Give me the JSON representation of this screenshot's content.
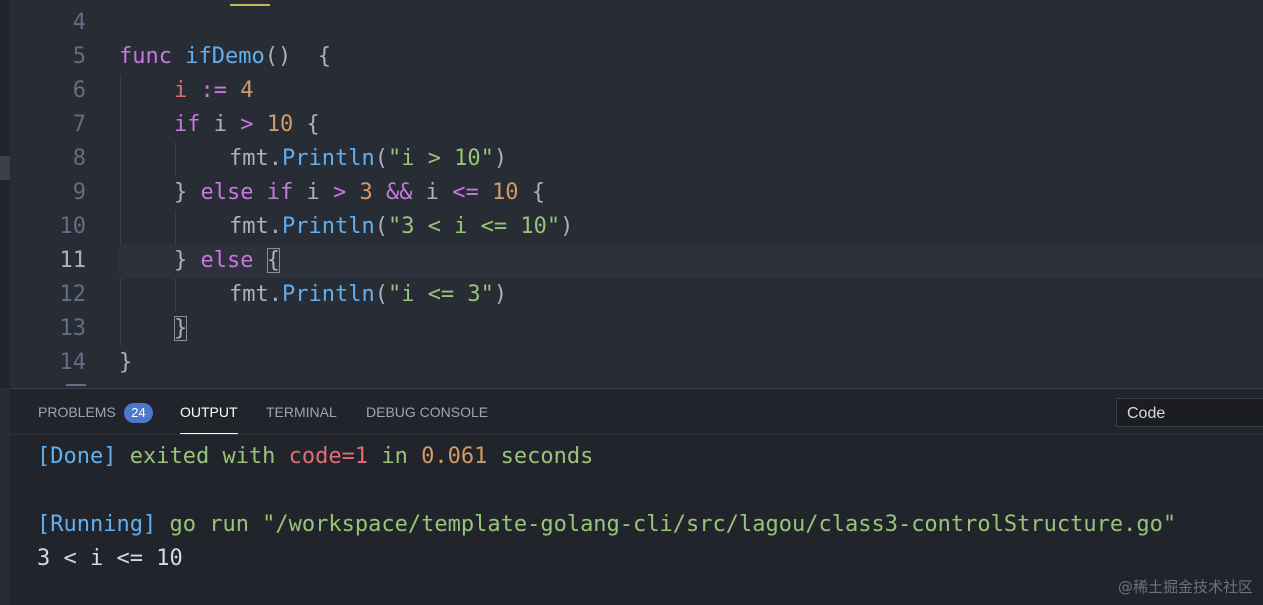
{
  "editor": {
    "active_line": "11",
    "lines": [
      {
        "num": "4"
      },
      {
        "num": "5",
        "t": [
          "func",
          " ",
          "ifDemo",
          "()  {"
        ]
      },
      {
        "num": "6",
        "t": [
          "i",
          " := ",
          "4"
        ]
      },
      {
        "num": "7",
        "t": [
          "if",
          " i ",
          ">",
          " ",
          "10",
          " {"
        ]
      },
      {
        "num": "8",
        "t": [
          "fmt.",
          "Println",
          "(",
          "\"i > 10\"",
          ")"
        ]
      },
      {
        "num": "9",
        "t": [
          "} ",
          "else if",
          " i ",
          ">",
          " ",
          "3",
          " ",
          "&&",
          " i ",
          "<=",
          " ",
          "10",
          " {"
        ]
      },
      {
        "num": "10",
        "t": [
          "fmt.",
          "Println",
          "(",
          "\"3 < i <= 10\"",
          ")"
        ]
      },
      {
        "num": "11",
        "t": [
          "} ",
          "else",
          " ",
          "{"
        ]
      },
      {
        "num": "12",
        "t": [
          "fmt.",
          "Println",
          "(",
          "\"i <= 3\"",
          ")"
        ]
      },
      {
        "num": "13",
        "t": [
          "}"
        ]
      },
      {
        "num": "14",
        "t": [
          "}"
        ]
      }
    ]
  },
  "panel": {
    "tabs": {
      "problems": "PROBLEMS",
      "problems_count": "24",
      "output": "OUTPUT",
      "terminal": "TERMINAL",
      "debug_console": "DEBUG CONSOLE"
    },
    "channel_select": "Code",
    "output": {
      "line1": [
        "[Done]",
        " exited with ",
        "code=1",
        " in ",
        "0.061",
        " seconds"
      ],
      "line2": [
        "[Running]",
        " go run \"/workspace/template-golang-cli/src/lagou/class3-controlStructure.go\""
      ],
      "line3": "3 < i <= 10"
    }
  },
  "watermark": "@稀土掘金技术社区",
  "colors": {
    "keyword": "#c678dd",
    "function": "#61afef",
    "variable": "#e06c75",
    "number": "#d19a66",
    "string": "#98c379",
    "badge": "#4d78cc"
  }
}
